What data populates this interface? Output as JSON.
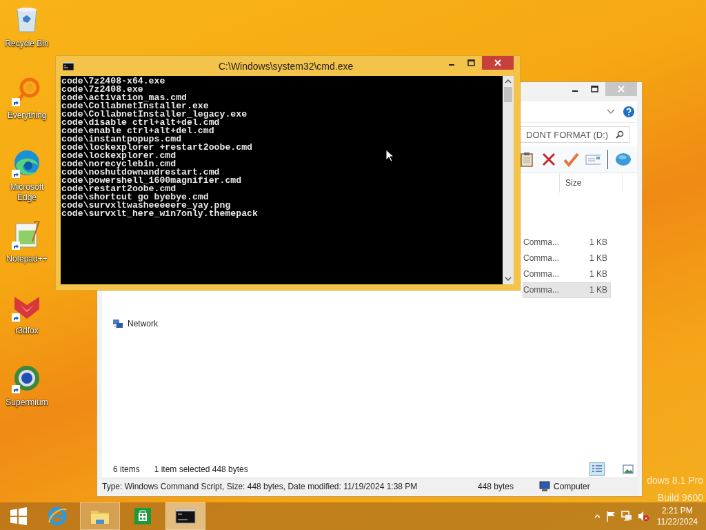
{
  "desktop_icons": [
    {
      "kind": "recycle-bin",
      "label": "Recycle Bin",
      "shortcut": false
    },
    {
      "kind": "everything",
      "label": "Everything",
      "shortcut": true
    },
    {
      "kind": "edge",
      "label": "Microsoft Edge",
      "shortcut": true
    },
    {
      "kind": "notepad",
      "label": "Notepad++",
      "shortcut": true
    },
    {
      "kind": "r3dfox",
      "label": "r3dfox",
      "shortcut": true
    },
    {
      "kind": "supermium",
      "label": "Supermium",
      "shortcut": true
    }
  ],
  "os_watermark": [
    "dows 8.1 Pro",
    "Build 9600"
  ],
  "explorer": {
    "search_placeholder": "DONT FORMAT (D:)",
    "column": "Size",
    "rows": [
      {
        "type": "Comma...",
        "size": "1 KB",
        "selected": false
      },
      {
        "type": "Comma...",
        "size": "1 KB",
        "selected": false
      },
      {
        "type": "Comma...",
        "size": "1 KB",
        "selected": false
      },
      {
        "type": "Comma...",
        "size": "1 KB",
        "selected": true
      }
    ],
    "nav_item": "Network",
    "status": {
      "count": "6 items",
      "selection": "1 item selected  448 bytes"
    },
    "details": {
      "info": "Type: Windows Command Script, Size: 448 bytes, Date modified: 11/19/2024 1:38 PM",
      "size": "448 bytes",
      "location": "Computer"
    }
  },
  "cmd": {
    "title": "C:\\Windows\\system32\\cmd.exe",
    "lines": [
      "code\\7z2408-x64.exe",
      "code\\7z2408.exe",
      "code\\activation_mas.cmd",
      "code\\CollabnetInstaller.exe",
      "code\\CollabnetInstaller_legacy.exe",
      "code\\disable ctrl+alt+del.cmd",
      "code\\enable ctrl+alt+del.cmd",
      "code\\instantpopups.cmd",
      "code\\lockexplorer +restart2oobe.cmd",
      "code\\lockexplorer.cmd",
      "code\\norecyclebin.cmd",
      "code\\noshutdownandrestart.cmd",
      "code\\powershell_1600magnifier.cmd",
      "code\\restart2oobe.cmd",
      "code\\shortcut go byebye.cmd",
      "code\\survxltwasheeeeere_yay.png",
      "code\\survxlt_here_win7only.themepack"
    ]
  },
  "taskbar": {
    "items": [
      {
        "kind": "ie",
        "running": false,
        "selected": false
      },
      {
        "kind": "explorer",
        "running": true,
        "selected": false
      },
      {
        "kind": "store",
        "running": false,
        "selected": false
      },
      {
        "kind": "cmd",
        "running": true,
        "selected": true
      }
    ],
    "clock": {
      "time": "2:21 PM",
      "date": "11/22/2024"
    }
  }
}
